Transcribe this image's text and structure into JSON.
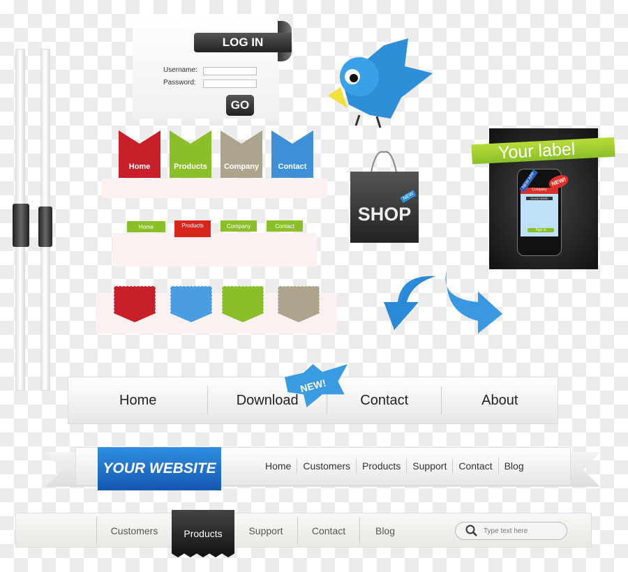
{
  "login": {
    "title": "LOG IN",
    "username_label": "Username:",
    "password_label": "Password:",
    "username_value": "",
    "password_value": "",
    "go_label": "GO"
  },
  "big_tabs": [
    {
      "label": "Home",
      "color": "#c8202a"
    },
    {
      "label": "Products",
      "color": "#8bbf2a"
    },
    {
      "label": "Company",
      "color": "#aea48e"
    },
    {
      "label": "Contact",
      "color": "#3d8fd8"
    }
  ],
  "small_tabs": [
    {
      "label": "Home",
      "color": "#8bbf2a"
    },
    {
      "label": "Products",
      "color": "#d9261c"
    },
    {
      "label": "Company",
      "color": "#8bbf2a"
    },
    {
      "label": "Contact",
      "color": "#8bbf2a"
    }
  ],
  "pockets": [
    "#c8202a",
    "#3d8fd8",
    "#8bbf2a",
    "#aea48e"
  ],
  "shop": {
    "label": "SHOP",
    "badge": "NEW"
  },
  "phone_box": {
    "label": "Your label",
    "ribbon": "NEW APP",
    "badge": "NEW!",
    "company": "Company",
    "click": "CLICK HERE!",
    "sign_in": "Sign in"
  },
  "nav1": {
    "items": [
      "Home",
      "Download",
      "Contact",
      "About"
    ],
    "badge": "NEW!"
  },
  "nav2": {
    "brand": "YOUR WEBSITE",
    "items": [
      "Home",
      "Customers",
      "Products",
      "Support",
      "Contact",
      "Blog"
    ]
  },
  "nav3": {
    "items": [
      "Customers",
      "Products",
      "Support",
      "Contact",
      "Blog"
    ],
    "active": "Products",
    "search_placeholder": "Type text here"
  }
}
